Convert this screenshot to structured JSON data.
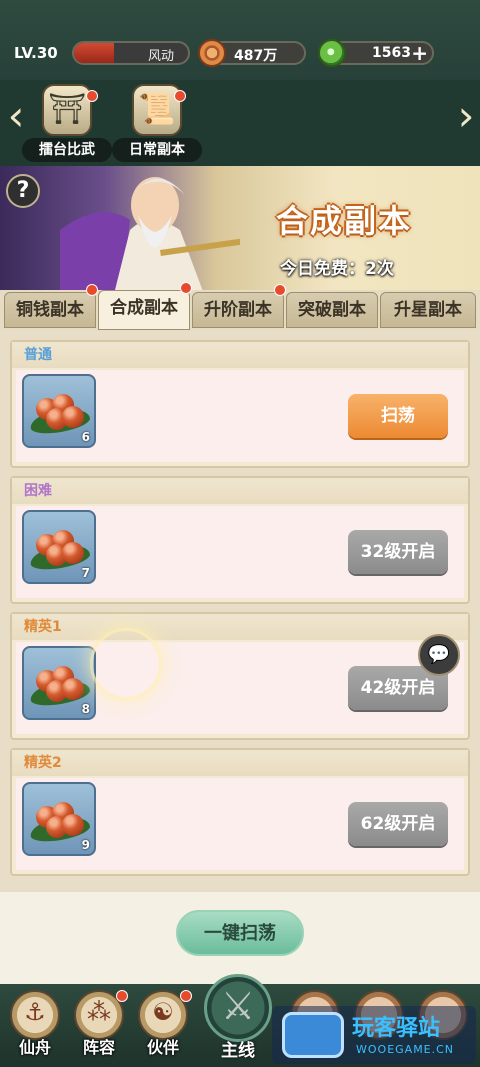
{
  "status": {
    "level": "LV.30",
    "hp_label": "风动",
    "hp_fill": 0.35,
    "copper": "487万",
    "jade": "1563"
  },
  "activities": [
    {
      "name": "擂台比武",
      "icon": "arena-icon",
      "has_dot": true
    },
    {
      "name": "日常副本",
      "icon": "scroll-icon",
      "has_dot": true
    }
  ],
  "banner": {
    "title": "合成副本",
    "free_text": "今日免费：2次",
    "help": "?"
  },
  "tabs": [
    {
      "label": "铜钱副本",
      "active": false,
      "has_dot": true
    },
    {
      "label": "合成副本",
      "active": true,
      "has_dot": true
    },
    {
      "label": "升阶副本",
      "active": false,
      "has_dot": true
    },
    {
      "label": "突破副本",
      "active": false,
      "has_dot": false
    },
    {
      "label": "升星副本",
      "active": false,
      "has_dot": false
    }
  ],
  "stages": [
    {
      "difficulty": "普通",
      "color": "#5aa0d8",
      "item_count": "6",
      "button": "扫荡",
      "button_style": "orange"
    },
    {
      "difficulty": "困难",
      "color": "#b074c8",
      "item_count": "7",
      "button": "32级开启",
      "button_style": "gray"
    },
    {
      "difficulty": "精英1",
      "color": "#e08a3a",
      "item_count": "8",
      "button": "42级开启",
      "button_style": "gray"
    },
    {
      "difficulty": "精英2",
      "color": "#e08a3a",
      "item_count": "9",
      "button": "62级开启",
      "button_style": "gray"
    }
  ],
  "sweep_all": "一键扫荡",
  "nav": [
    {
      "label": "仙舟",
      "icon": "ship-icon"
    },
    {
      "label": "阵容",
      "icon": "formation-icon"
    },
    {
      "label": "伙伴",
      "icon": "partner-icon"
    },
    {
      "label": "主线",
      "icon": "crossed-swords-icon"
    }
  ],
  "watermark": {
    "title": "玩客驿站",
    "url": "WOOEGAME.CN"
  }
}
